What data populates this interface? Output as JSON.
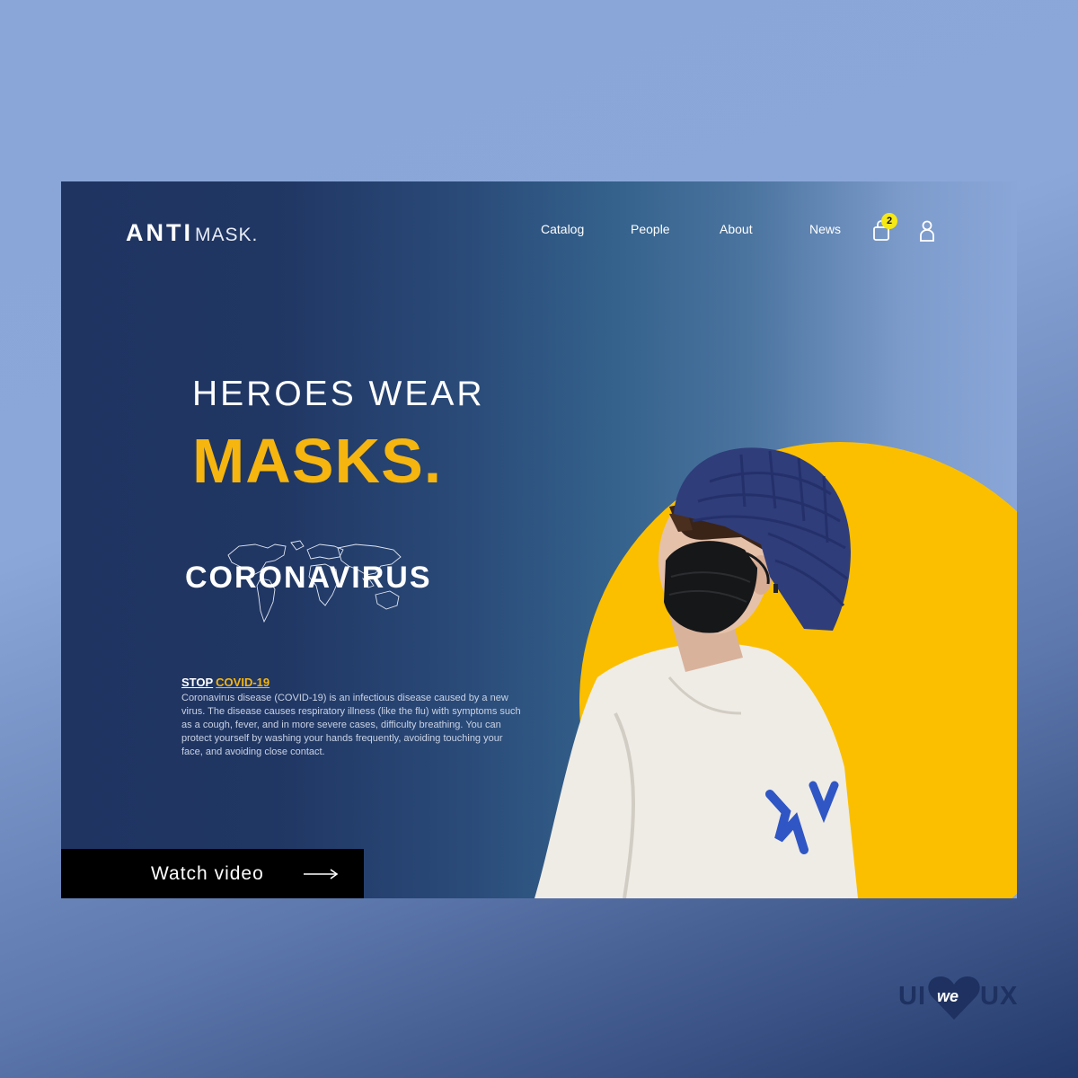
{
  "brand": {
    "name_bold": "ANTI",
    "name_light": "MASK."
  },
  "nav": {
    "items": [
      "Catalog",
      "People",
      "About",
      "News"
    ]
  },
  "cart": {
    "count": "2"
  },
  "hero": {
    "line1": "HEROES WEAR",
    "line2": "MASKS."
  },
  "coronavirus": {
    "title": "CORONAVIRUS"
  },
  "info": {
    "stop": "STOP",
    "covid": "COVID-19",
    "body": "Coronavirus disease (COVID-19) is an infectious disease caused by a new virus. The disease causes respiratory illness (like the flu) with symptoms such as a cough, fever, and in more severe cases, difficulty breathing. You can protect yourself by washing your hands frequently, avoiding touching your face, and avoiding close contact."
  },
  "cta": {
    "label": "Watch video"
  },
  "watermark": {
    "left": "UI",
    "heart": "we",
    "right": "UX"
  },
  "colors": {
    "accent_yellow": "#fbbf00",
    "navy": "#1f3461",
    "badge_yellow": "#f6e815"
  },
  "icons": [
    "shopping-bag-icon",
    "user-icon",
    "arrow-right-icon",
    "world-map-icon",
    "heart-icon"
  ]
}
